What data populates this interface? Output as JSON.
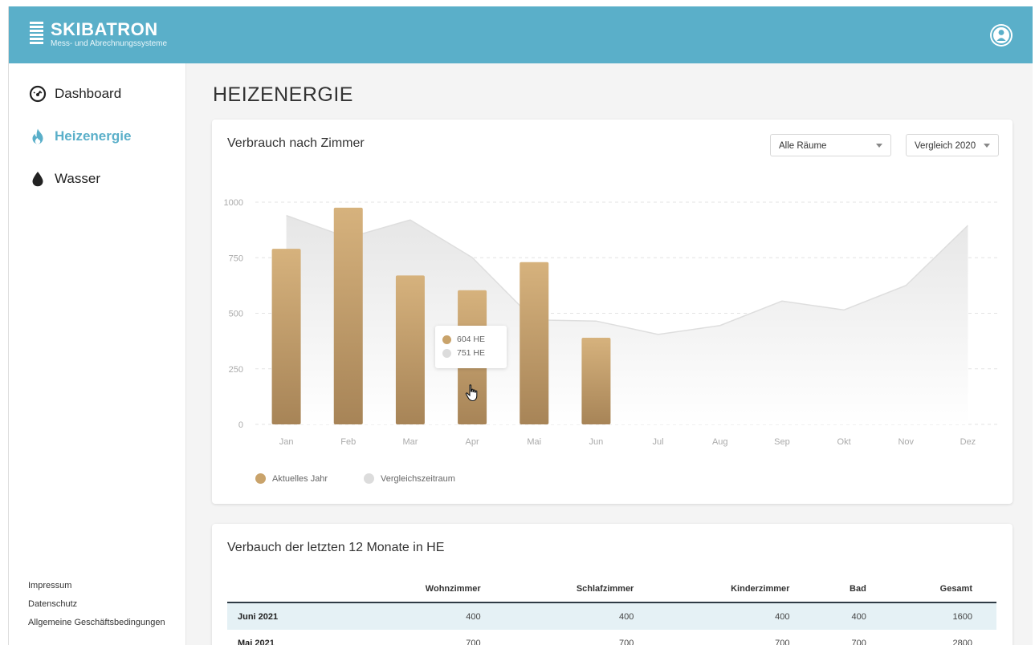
{
  "header": {
    "brand_name": "SKIBATRON",
    "brand_sub": "Mess- und Abrechnungssysteme",
    "user_icon": "user-icon",
    "accent": "#5aafc9"
  },
  "sidebar": {
    "items": [
      {
        "label": "Dashboard",
        "icon": "gauge-icon",
        "active": false
      },
      {
        "label": "Heizenergie",
        "icon": "flame-icon",
        "active": true
      },
      {
        "label": "Wasser",
        "icon": "drop-icon",
        "active": false
      }
    ],
    "footer_links": [
      "Impressum",
      "Datenschutz",
      "Allgemeine Geschäftsbedingungen"
    ]
  },
  "page": {
    "title": "HEIZENERGIE"
  },
  "chart_card": {
    "title": "Verbrauch nach Zimmer",
    "room_select": "Alle Räume",
    "compare_select": "Vergleich 2020",
    "tooltip": {
      "current": "604 HE",
      "compare": "751 HE"
    },
    "legend": [
      {
        "label": "Aktuelles Jahr",
        "color": "#c9a36b"
      },
      {
        "label": "Vergleichszeitraum",
        "color": "#dcdcdc"
      }
    ]
  },
  "chart_data": {
    "type": "bar",
    "categories": [
      "Jan",
      "Feb",
      "Mar",
      "Apr",
      "Mai",
      "Jun",
      "Jul",
      "Aug",
      "Sep",
      "Okt",
      "Nov",
      "Dez"
    ],
    "series": [
      {
        "name": "Aktuelles Jahr",
        "kind": "bar",
        "color": "#b8935e",
        "values": [
          790,
          975,
          670,
          604,
          730,
          390,
          null,
          null,
          null,
          null,
          null,
          null
        ]
      },
      {
        "name": "Vergleichszeitraum",
        "kind": "area",
        "color": "#e2e2e2",
        "values": [
          940,
          840,
          920,
          751,
          470,
          465,
          405,
          445,
          555,
          515,
          625,
          895
        ]
      }
    ],
    "yticks": [
      0,
      250,
      500,
      750,
      1000
    ],
    "ylim": [
      0,
      1000
    ],
    "grid": true,
    "legend_position": "bottom-left"
  },
  "table_card": {
    "title": "Verbauch der letzten 12 Monate in HE",
    "columns": [
      "",
      "Wohnzimmer",
      "Schlafzimmer",
      "Kinderzimmer",
      "Bad",
      "Gesamt"
    ],
    "rows": [
      {
        "month": "Juni 2021",
        "values": [
          "400",
          "400",
          "400",
          "400",
          "1600"
        ]
      },
      {
        "month": "Mai 2021",
        "values": [
          "700",
          "700",
          "700",
          "700",
          "2800"
        ]
      }
    ]
  }
}
